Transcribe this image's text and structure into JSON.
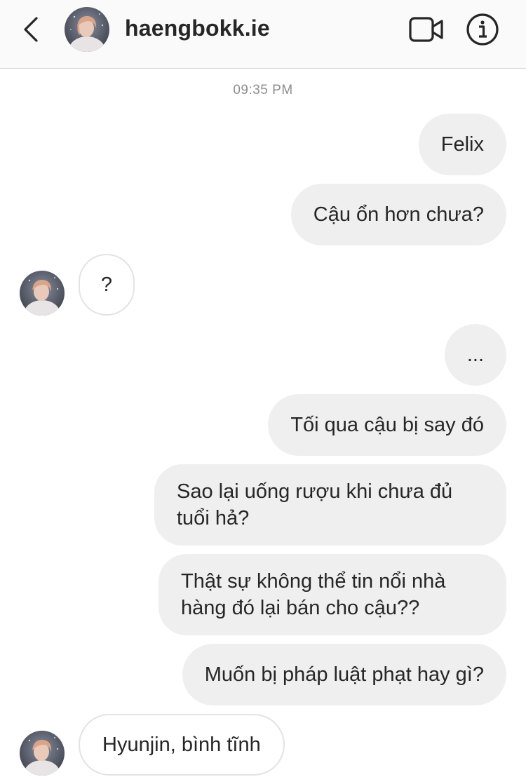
{
  "header": {
    "username": "haengbokk.ie",
    "back_icon": "chevron-left-icon",
    "video_icon": "video-camera-icon",
    "info_icon": "info-icon"
  },
  "timestamp": "09:35 PM",
  "messages": [
    {
      "direction": "sent",
      "text": "Felix"
    },
    {
      "direction": "sent",
      "text": "Cậu ổn hơn chưa?"
    },
    {
      "direction": "received",
      "text": "?"
    },
    {
      "direction": "sent",
      "text": "..."
    },
    {
      "direction": "sent",
      "text": "Tối qua cậu bị say đó"
    },
    {
      "direction": "sent",
      "text": "Sao lại uống rượu khi chưa đủ tuổi hả?"
    },
    {
      "direction": "sent",
      "text": "Thật sự không thể tin nổi nhà hàng đó lại bán cho cậu??"
    },
    {
      "direction": "sent",
      "text": "Muốn bị pháp luật phạt hay gì?"
    },
    {
      "direction": "received",
      "text": "Hyunjin, bình tĩnh"
    }
  ],
  "colors": {
    "sent_bubble": "#efefef",
    "received_border": "#e3e3e3",
    "text": "#262626",
    "muted": "#8e8e8e",
    "header_bg": "#fafafa"
  }
}
